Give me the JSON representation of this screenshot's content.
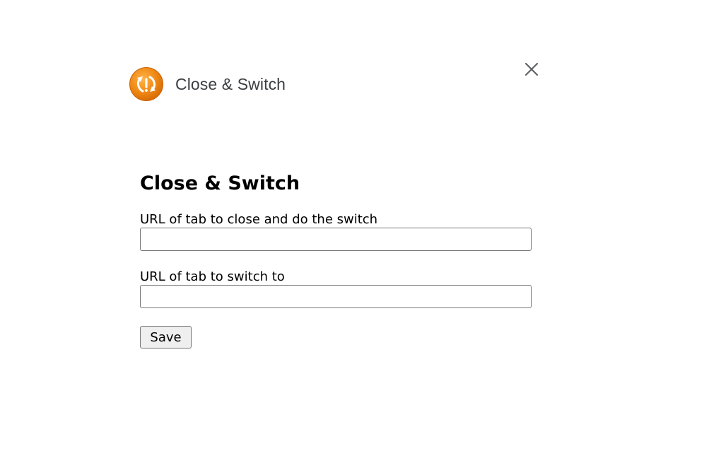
{
  "header": {
    "title": "Close & Switch",
    "logo_icon": "orange-switch-logo-icon",
    "close_icon": "close-icon"
  },
  "colors": {
    "logo_orange": "#f08a16",
    "logo_orange_dark": "#d96d04",
    "text": "#000000",
    "header_text": "#3c4043"
  },
  "form": {
    "heading": "Close & Switch",
    "close_url_label": "URL of tab to close and do the switch",
    "close_url_value": "",
    "switch_url_label": "URL of tab to switch to",
    "switch_url_value": "",
    "save_label": "Save"
  }
}
